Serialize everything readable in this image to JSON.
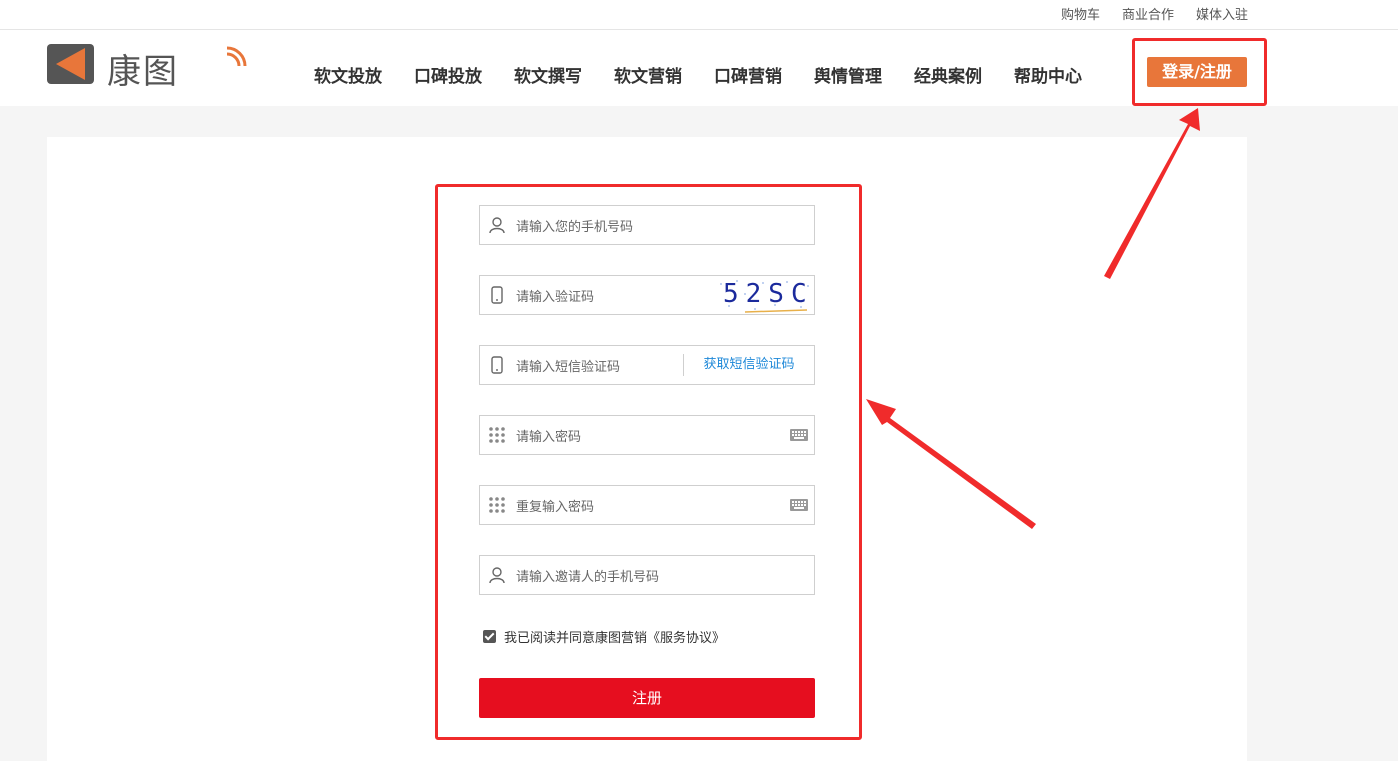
{
  "topbar": {
    "links": [
      "购物车",
      "商业合作",
      "媒体入驻"
    ]
  },
  "header": {
    "logo_text": "康图",
    "nav": [
      "软文投放",
      "口碑投放",
      "软文撰写",
      "软文营销",
      "口碑营销",
      "舆情管理",
      "经典案例",
      "帮助中心"
    ],
    "login_label": "登录/注册"
  },
  "form": {
    "phone_placeholder": "请输入您的手机号码",
    "captcha_placeholder": "请输入验证码",
    "captcha_text": "52SC",
    "sms_placeholder": "请输入短信验证码",
    "sms_button": "获取短信验证码",
    "password_placeholder": "请输入密码",
    "repeat_password_placeholder": "重复输入密码",
    "inviter_placeholder": "请输入邀请人的手机号码",
    "agree_text": "我已阅读并同意康图营销",
    "agreement_link": "《服务协议》",
    "agree_checked": true,
    "submit_label": "注册"
  },
  "colors": {
    "brand_orange": "#e8763a",
    "submit_red": "#e60e1f",
    "link_blue": "#1e88d8",
    "annotation_red": "#f02b2b"
  }
}
